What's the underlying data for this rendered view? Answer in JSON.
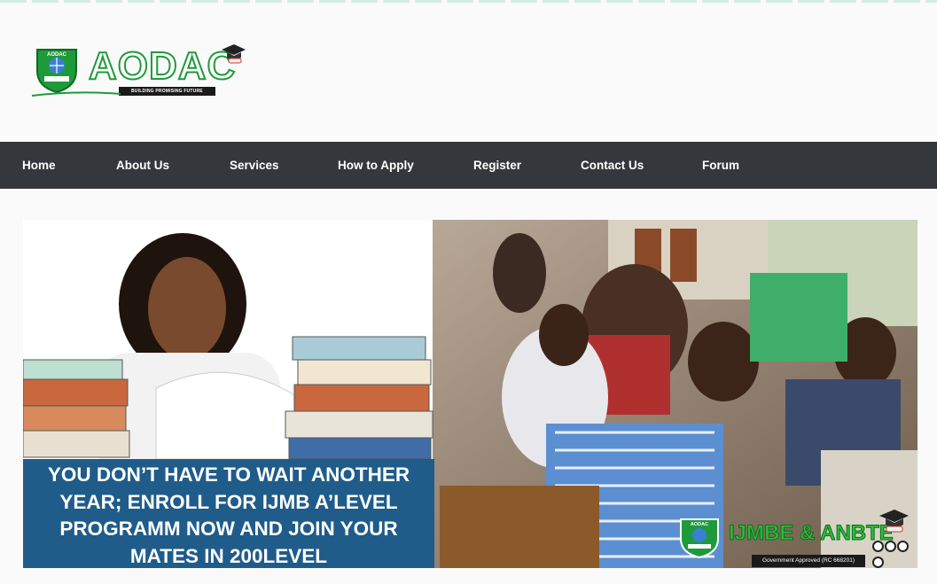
{
  "logo": {
    "name": "AODAC",
    "tagline": "BUILDING PROMISING FUTURE",
    "shield_text": "AODAC",
    "colors": {
      "green": "#1f9a3a",
      "dark": "#1a1a1a"
    }
  },
  "nav": {
    "items": [
      {
        "label": "Home"
      },
      {
        "label": "About Us"
      },
      {
        "label": "Services"
      },
      {
        "label": "How to Apply"
      },
      {
        "label": "Register"
      },
      {
        "label": "Contact Us"
      },
      {
        "label": "Forum"
      }
    ],
    "background": "#34373b"
  },
  "slider": {
    "caption_lines": [
      "YOU DON’T HAVE TO WAIT ANOTHER",
      "YEAR; ENROLL FOR IJMB A’LEVEL",
      "PROGRAMM NOW AND JOIN YOUR",
      "MATES IN 200LEVEL"
    ],
    "brand_title": "IJMBE & ANBTE",
    "brand_sub": "Government Approved (RC 668201)",
    "brand_shield_text": "AODAC",
    "dot_count": 4,
    "caption_color": "#1f5c8a"
  }
}
